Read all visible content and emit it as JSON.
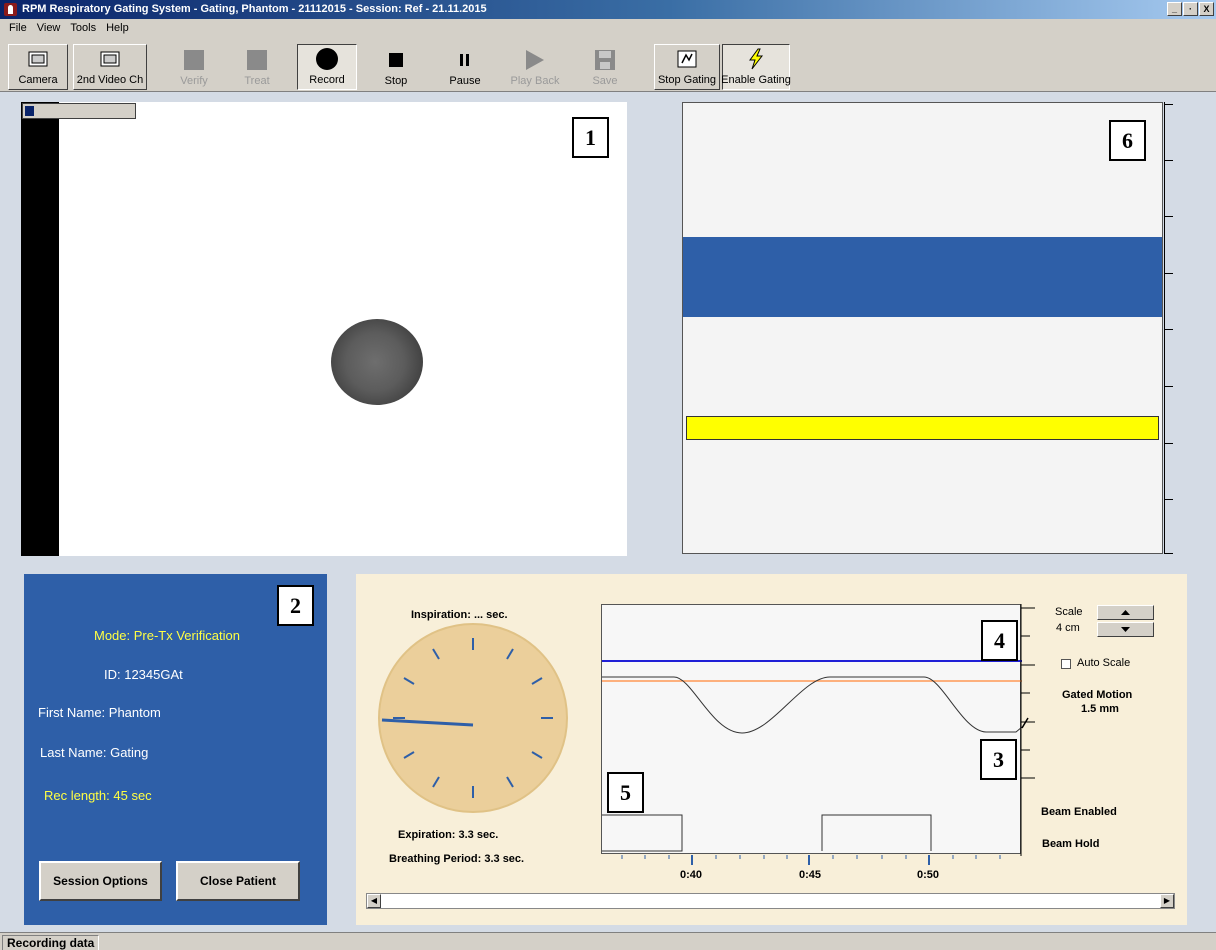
{
  "window": {
    "title": "RPM Respiratory Gating System  - Gating, Phantom  - 21112015 - Session: Ref  -  21.11.2015",
    "controls": [
      "_",
      "·",
      "X"
    ]
  },
  "menu": [
    "File",
    "View",
    "Tools",
    "Help"
  ],
  "toolbar": {
    "camera": "Camera",
    "video2": "2nd Video Ch",
    "verify": "Verify",
    "treat": "Treat",
    "record": "Record",
    "stop": "Stop",
    "pause": "Pause",
    "playback": "Play Back",
    "save": "Save",
    "stop_gating": "Stop Gating",
    "enable_gating": "Enable Gating"
  },
  "video": {
    "label": "1",
    "progress": 0.08
  },
  "gate": {
    "label": "6"
  },
  "patient": {
    "label": "2",
    "mode": "Mode: Pre-Tx Verification",
    "id": "ID:  12345GAt",
    "first_name": "First Name:  Phantom",
    "last_name": "Last Name:  Gating",
    "rec_length": "Rec length:  45 sec",
    "session_options": "Session Options",
    "close_patient": "Close Patient"
  },
  "breathing": {
    "inspiration": "Inspiration: ... sec.",
    "expiration": "Expiration: 3.3 sec.",
    "period": "Breathing Period: 3.3 sec."
  },
  "trace": {
    "label_4": "4",
    "label_3": "3",
    "label_5": "5",
    "scale_label": "Scale",
    "scale_value": "4  cm",
    "auto_scale": "Auto Scale",
    "gated_motion": "Gated Motion",
    "gated_motion_value": "1.5 mm",
    "beam_enabled": "Beam Enabled",
    "beam_hold": "Beam Hold",
    "time_labels": [
      "0:40",
      "0:45",
      "0:50"
    ]
  },
  "colors": {
    "panel_blue": "#2e5fa8",
    "gate_yellow": "#ffff00",
    "threshold_blue": "#1f1fd6",
    "threshold_orange": "#ff9955"
  },
  "status": "Recording data"
}
